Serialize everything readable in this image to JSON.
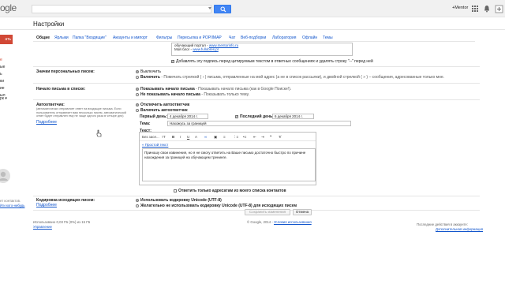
{
  "header": {
    "logo_text": "ogle",
    "user_name": "+Mentor",
    "page_title": "Настройки"
  },
  "sidebar": {
    "compose_label": "ать",
    "items": [
      {
        "label": "е",
        "style": "red"
      },
      {
        "label": "ые",
        "style": "normal"
      },
      {
        "label": "ь",
        "style": "normal"
      },
      {
        "label": "ки",
        "style": "normal"
      },
      {
        "label": "ие",
        "style": "normal"
      },
      {
        "label": "ыл",
        "style": "normal"
      },
      {
        "label": "рк ▾",
        "style": "normal"
      }
    ],
    "no_contacts": "ет контактов.",
    "find_link": "йти кого-нибудь"
  },
  "tabs": [
    {
      "label": "Общие",
      "active": true
    },
    {
      "label": "Ярлыки",
      "active": false
    },
    {
      "label": "Папка \"Входящие\"",
      "active": false
    },
    {
      "label": "Аккаунты и импорт",
      "active": false
    },
    {
      "label": "Фильтры",
      "active": false
    },
    {
      "label": "Пересылка и POP/IMAP",
      "active": false
    },
    {
      "label": "Чат",
      "active": false
    },
    {
      "label": "Веб-подборки",
      "active": false
    },
    {
      "label": "Лаборатория",
      "active": false
    },
    {
      "label": "Офлайн",
      "active": false
    },
    {
      "label": "Темы",
      "active": false
    }
  ],
  "signature": {
    "line1": "обучающий портал - ",
    "line1_link": "www.mentorinfo.ru",
    "line2": "Мой блог - ",
    "line2_link": "www.fullobres.pl",
    "insert_option": "Добавлять эту подпись перед цитируемым текстом в ответных сообщениях и удалять строку \"--\" перед ней"
  },
  "personal_icons": {
    "label": "Значки персональных писем:",
    "off": "Выключить",
    "on_bold": "Включить",
    "on_desc": " - Помечать стрелкой ( › ) письма, отправленные на мой адрес (а не в список рассылки), и двойной стрелкой ( » ) – сообщения, адресованные только мне."
  },
  "snippets": {
    "label": "Начало письма в списке:",
    "show_bold": "Показывать начало письма",
    "show_desc": " - Показывать начало письма (как в Google Поиске!).",
    "hide_bold": "Не показывать начало письма",
    "hide_desc": " - Показывать только тему."
  },
  "vacation": {
    "label": "Автоответчик:",
    "desc": "(автоматически отправляет ответ на входящие письма. Если пользователь отправляет вам несколько писем, автоматический ответ будет отправлен ему не чаще одного раза в четыре дня)",
    "more_link": "Подробнее",
    "off": "Отключить автоответчик",
    "on": "Включить автоответчик",
    "first_day_label": "Первый день:",
    "first_day_value": "4 декабря 2014 г.",
    "last_day_label": "Последний день:",
    "last_day_value": "6 декабря 2014 г.",
    "subject_label": "Тема:",
    "subject_value": "Нахожусь за границей",
    "text_label": "Текст:",
    "font_name": "Без засе...",
    "plain_text_link": "« Простой текст",
    "body": "Приношу свои извинения, но я не смогу ответить на Ваше письмо достаточно быстро по причине нахождения за границей на обучающем тренинге.",
    "contacts_only": "Ответить только адресатам из моего списка контактов"
  },
  "encoding": {
    "label": "Кодировка исходящих писем:",
    "more_link": "Подробнее",
    "unicode": "Использовать кодировку Unicode (UTF-8)",
    "default": "Желательно не использовать кодировку Unicode (UTF-8) для исходящих писем"
  },
  "buttons": {
    "save": "Сохранить изменения",
    "cancel": "Отмена"
  },
  "footer": {
    "storage": "Использовано 0,03 ГБ (0%) из 15 ГБ",
    "manage": "Управление",
    "copyright": "© Google, 2014 - ",
    "terms": "Условия использования",
    "last_activity": "Последние действия в аккаунте:",
    "details": "Дополнительная информация"
  },
  "colors": {
    "accent": "#4285f4",
    "compose": "#d14836",
    "link": "#1155cc"
  }
}
